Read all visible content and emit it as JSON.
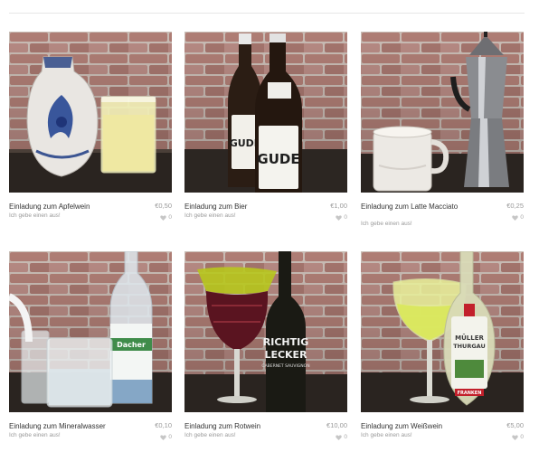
{
  "colors": {
    "title": "#333333",
    "muted": "#9a9a9a",
    "brick": "#b8837a",
    "mortar": "#d8ccc4"
  },
  "items": [
    {
      "title": "Einladung zum Apfelwein",
      "subtitle": "Ich gebe einen aus!",
      "price": "€0,50",
      "likes": "0"
    },
    {
      "title": "Einladung zum Bier",
      "subtitle": "Ich gebe einen aus!",
      "price": "€1,00",
      "likes": "0"
    },
    {
      "title": "Einladung zum Latte Macciato",
      "subtitle": "Ich gebe einen aus!",
      "price": "€0,25",
      "likes": "0"
    },
    {
      "title": "Einladung zum Mineralwasser",
      "subtitle": "Ich gebe einen aus!",
      "price": "€0,10",
      "likes": "0"
    },
    {
      "title": "Einladung zum Rotwein",
      "subtitle": "Ich gebe einen aus!",
      "price": "€10,00",
      "likes": "0"
    },
    {
      "title": "Einladung zum Weißwein",
      "subtitle": "Ich gebe einen aus!",
      "price": "€5,00",
      "likes": "0"
    }
  ],
  "labels": {
    "beer_brand": "GUDE",
    "water_brand": "Dacher",
    "red_wine_line1": "RICHTIG",
    "red_wine_line2": "LECKER",
    "red_wine_line3": "CABERNET SAUVIGNON",
    "white_wine_line1": "MÜLLER",
    "white_wine_line2": "THURGAU",
    "white_wine_banner": "FRANKEN"
  }
}
